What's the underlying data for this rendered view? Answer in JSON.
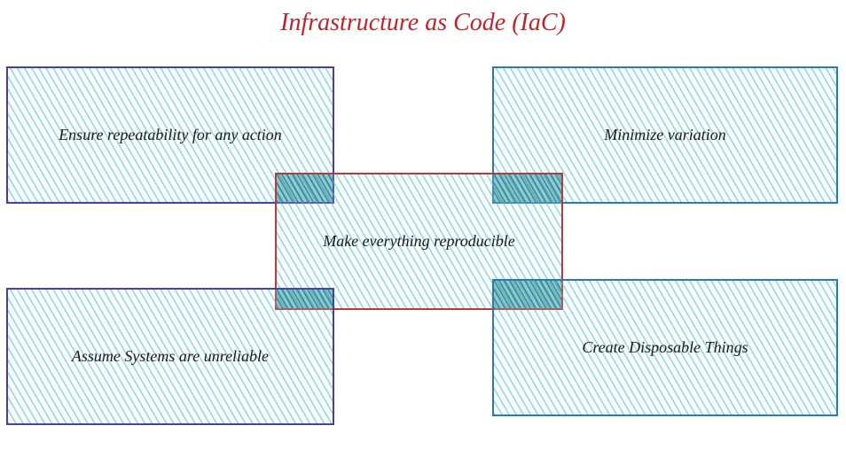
{
  "title": "Infrastructure as Code (IaC)",
  "boxes": {
    "top_left": {
      "label": "Ensure repeatability for any action"
    },
    "top_right": {
      "label": "Minimize variation"
    },
    "center": {
      "label": "Make everything reproducible"
    },
    "bottom_left": {
      "label": "Assume Systems are unreliable"
    },
    "bottom_right": {
      "label": "Create Disposable Things"
    }
  }
}
